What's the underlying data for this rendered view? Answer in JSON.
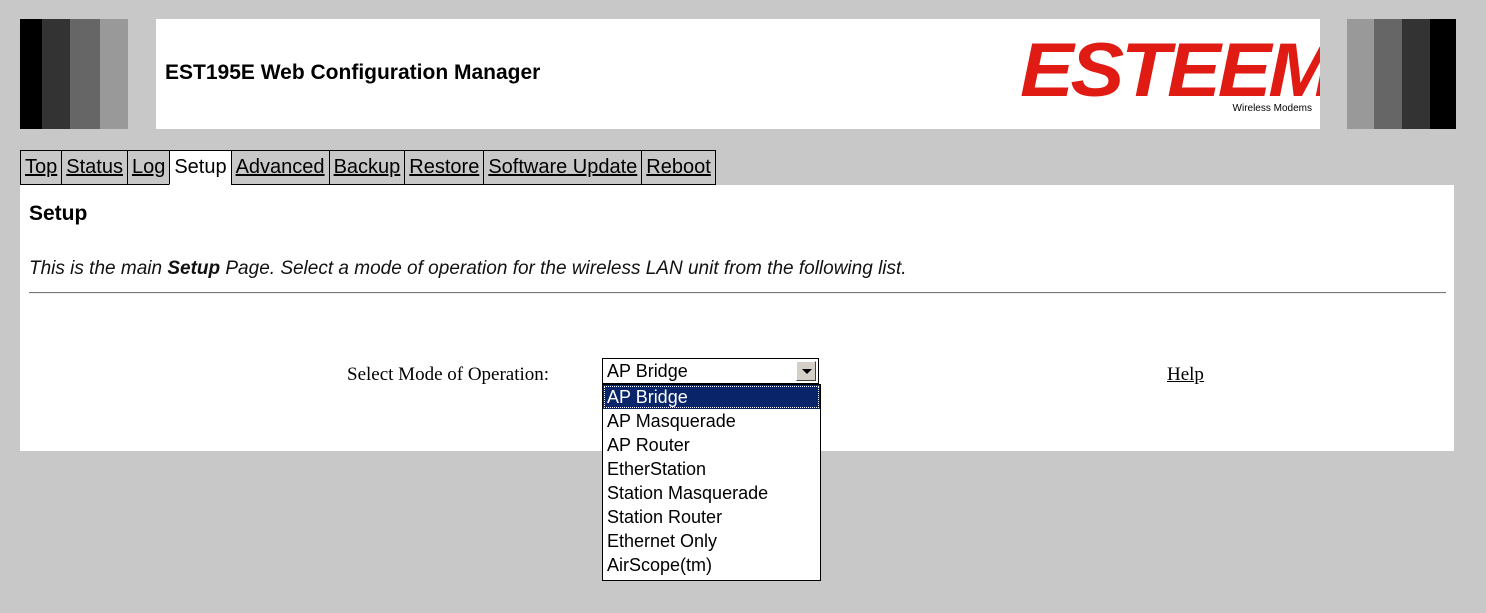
{
  "header": {
    "title": "EST195E Web Configuration Manager",
    "logo_text": "ESTEEM",
    "logo_subtext": "Wireless Modems",
    "brand_color": "#e01b14"
  },
  "tabs": [
    {
      "label": "Top",
      "active": false
    },
    {
      "label": "Status",
      "active": false
    },
    {
      "label": "Log",
      "active": false
    },
    {
      "label": "Setup",
      "active": true
    },
    {
      "label": "Advanced",
      "active": false
    },
    {
      "label": "Backup",
      "active": false
    },
    {
      "label": "Restore",
      "active": false
    },
    {
      "label": "Software Update",
      "active": false
    },
    {
      "label": "Reboot",
      "active": false
    }
  ],
  "main": {
    "page_title": "Setup",
    "desc_pre": "This is the main ",
    "desc_bold": "Setup",
    "desc_post": " Page. Select a mode of operation for the wireless LAN unit from the following list.",
    "select_label": "Select Mode of Operation:",
    "select_value": "AP Bridge",
    "help_link": "Help",
    "options": [
      "AP Bridge",
      "AP Masquerade",
      "AP Router",
      "EtherStation",
      "Station Masquerade",
      "Station Router",
      "Ethernet Only",
      "AirScope(tm)"
    ],
    "highlighted_option": "AP Bridge"
  }
}
